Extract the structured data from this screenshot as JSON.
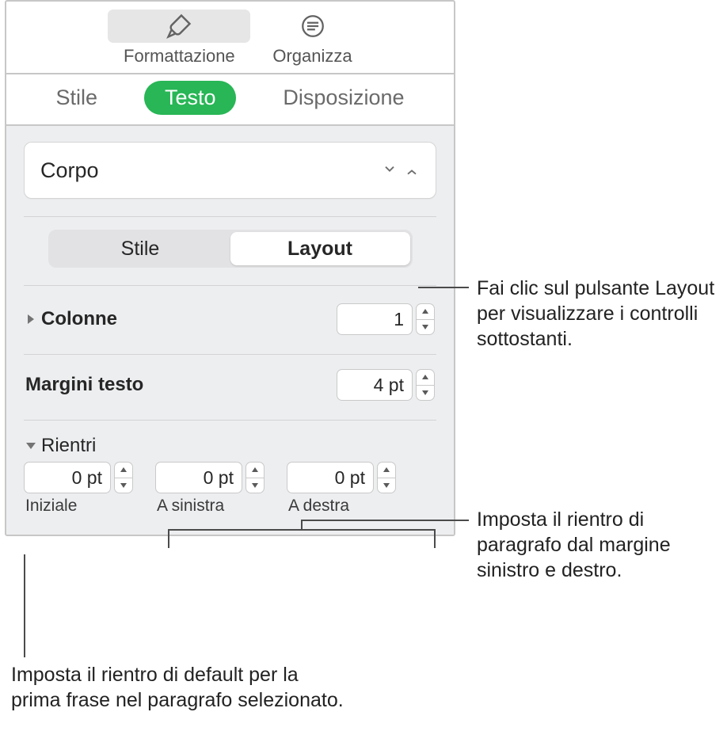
{
  "topbar": {
    "format_label": "Formattazione",
    "arrange_label": "Organizza"
  },
  "tabs": {
    "style": "Stile",
    "text": "Testo",
    "layout": "Disposizione"
  },
  "style_picker": {
    "value": "Corpo"
  },
  "seg": {
    "style": "Stile",
    "layout": "Layout"
  },
  "columns": {
    "label": "Colonne",
    "value": "1"
  },
  "text_margins": {
    "label": "Margini testo",
    "value": "4 pt"
  },
  "indents": {
    "label": "Rientri",
    "first": {
      "value": "0 pt",
      "label": "Iniziale"
    },
    "left": {
      "value": "0 pt",
      "label": "A sinistra"
    },
    "right": {
      "value": "0 pt",
      "label": "A destra"
    }
  },
  "callouts": {
    "layout": "Fai clic sul pulsante Layout per visualizzare i controlli sottostanti.",
    "lr": "Imposta il rientro di paragrafo dal margine sinistro e destro.",
    "first": "Imposta il rientro di default per la prima frase nel paragrafo selezionato."
  }
}
